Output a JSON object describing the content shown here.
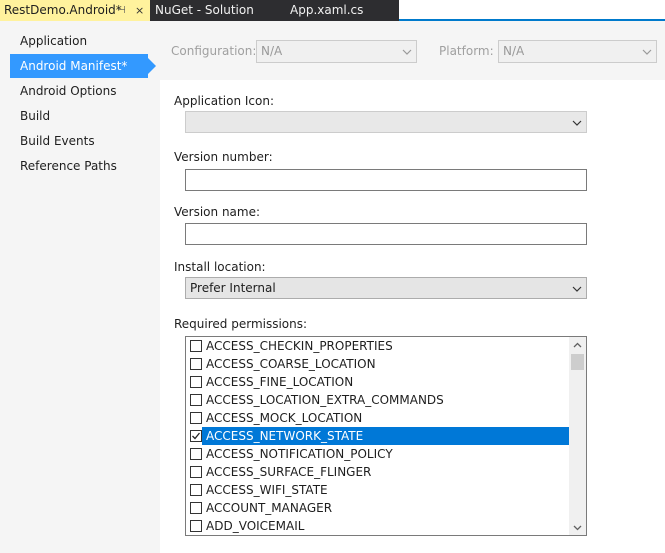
{
  "tabs": [
    {
      "label": "RestDemo.Android*",
      "pin_glyph": "⊣",
      "close_glyph": "×"
    },
    {
      "label": "NuGet - Solution"
    },
    {
      "label": "App.xaml.cs"
    }
  ],
  "nav": {
    "items": [
      {
        "label": "Application"
      },
      {
        "label": "Android Manifest*"
      },
      {
        "label": "Android Options"
      },
      {
        "label": "Build"
      },
      {
        "label": "Build Events"
      },
      {
        "label": "Reference Paths"
      }
    ]
  },
  "config": {
    "configuration_label": "Configuration:",
    "configuration_value": "N/A",
    "platform_label": "Platform:",
    "platform_value": "N/A"
  },
  "form": {
    "app_icon_label": "Application Icon:",
    "app_icon_value": "",
    "version_number_label": "Version number:",
    "version_number_value": "",
    "version_name_label": "Version name:",
    "version_name_value": "",
    "install_location_label": "Install location:",
    "install_location_value": "Prefer Internal",
    "permissions_label": "Required permissions:"
  },
  "permissions": [
    {
      "name": "ACCESS_CHECKIN_PROPERTIES",
      "checked": false
    },
    {
      "name": "ACCESS_COARSE_LOCATION",
      "checked": false
    },
    {
      "name": "ACCESS_FINE_LOCATION",
      "checked": false
    },
    {
      "name": "ACCESS_LOCATION_EXTRA_COMMANDS",
      "checked": false
    },
    {
      "name": "ACCESS_MOCK_LOCATION",
      "checked": false
    },
    {
      "name": "ACCESS_NETWORK_STATE",
      "checked": true
    },
    {
      "name": "ACCESS_NOTIFICATION_POLICY",
      "checked": false
    },
    {
      "name": "ACCESS_SURFACE_FLINGER",
      "checked": false
    },
    {
      "name": "ACCESS_WIFI_STATE",
      "checked": false
    },
    {
      "name": "ACCOUNT_MANAGER",
      "checked": false
    },
    {
      "name": "ADD_VOICEMAIL",
      "checked": false
    }
  ],
  "colors": {
    "active_tab": "#fff29d",
    "selection": "#0078d7",
    "nav_selection": "#3399ff",
    "accent": "#007acc"
  }
}
